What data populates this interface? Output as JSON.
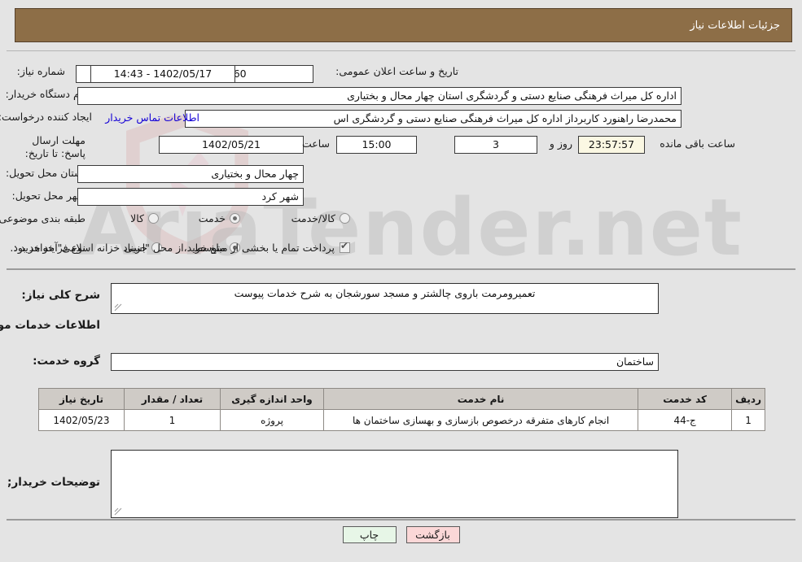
{
  "header": {
    "title": "جزئیات اطلاعات نیاز"
  },
  "colors": {
    "header_bg": "#8d6e47",
    "page_bg": "#e4e4e4",
    "link": "#1400d6",
    "table_header_bg": "#cfcbc6",
    "print_button_bg": "#e7f6e7",
    "back_button_bg": "#fbd7d7",
    "countdown_bg": "#fbf8e3"
  },
  "watermark": {
    "text": "AriaTender.net"
  },
  "form": {
    "need_number_label": "شماره نیاز:",
    "need_number_value": "1102003289000060",
    "announce_datetime_label": "تاریخ و ساعت اعلان عمومی:",
    "announce_datetime_value": "1402/05/17 - 14:43",
    "buyer_org_label": "نام دستگاه خریدار:",
    "buyer_org_value": "اداره کل میراث فرهنگی  صنایع دستی و گردشگری استان چهار محال و بختیاری",
    "requester_label": "ایجاد کننده درخواست:",
    "requester_value": "محمدرضا راهنورد کاربرداز اداره کل میراث فرهنگی  صنایع دستی و گردشگری اس",
    "buyer_contact_link": "اطلاعات تماس خریدار",
    "deadline_label": "مهلت ارسال پاسخ: تا تاریخ:",
    "deadline_date": "1402/05/21",
    "deadline_hour_label": "ساعت",
    "deadline_time": "15:00",
    "remaining_days": "3",
    "remaining_days_suffix": "روز و",
    "remaining_clock": "23:57:57",
    "remaining_clock_suffix": "ساعت باقی مانده",
    "province_label": "استان محل تحویل:",
    "province_value": "چهار محال و بختیاری",
    "city_label": "شهر محل تحویل:",
    "city_value": "شهر کرد",
    "classification_label": "طبقه بندی موضوعی:",
    "classification_options": [
      {
        "label": "کالا",
        "selected": false
      },
      {
        "label": "خدمت",
        "selected": true
      },
      {
        "label": "کالا/خدمت",
        "selected": false
      }
    ],
    "purchase_type_label": "نوع فرآیند خرید :",
    "purchase_type_options": [
      {
        "label": "جزیی",
        "selected": false
      },
      {
        "label": "متوسط",
        "selected": true
      }
    ],
    "treasury_checkbox_label": "پرداخت تمام یا بخشی از مبلغ خرید،از محل \"اسناد خزانه اسلامی\" خواهد بود.",
    "treasury_checkbox_checked": true,
    "general_description_label": "شرح کلی نیاز:",
    "general_description_value": "تعمیرومرمت باروی چالشتر و مسجد سورشجان به شرح خدمات پیوست",
    "services_section_title": "اطلاعات خدمات مورد نیاز",
    "service_group_label": "گروه خدمت:",
    "service_group_value": "ساختمان",
    "buyer_notes_label": "توضیحات خریدار;",
    "buyer_notes_value": ""
  },
  "table": {
    "columns": [
      "ردیف",
      "کد خدمت",
      "نام خدمت",
      "واحد اندازه گیری",
      "تعداد / مقدار",
      "تاریخ نیاز"
    ],
    "rows": [
      {
        "row_no": "1",
        "service_code": "ج-44",
        "service_name": "انجام کارهای متفرقه درخصوص بازسازی و بهسازی ساختمان ها",
        "unit": "پروژه",
        "quantity": "1",
        "need_date": "1402/05/23"
      }
    ]
  },
  "buttons": {
    "print": "چاپ",
    "back": "بازگشت"
  }
}
